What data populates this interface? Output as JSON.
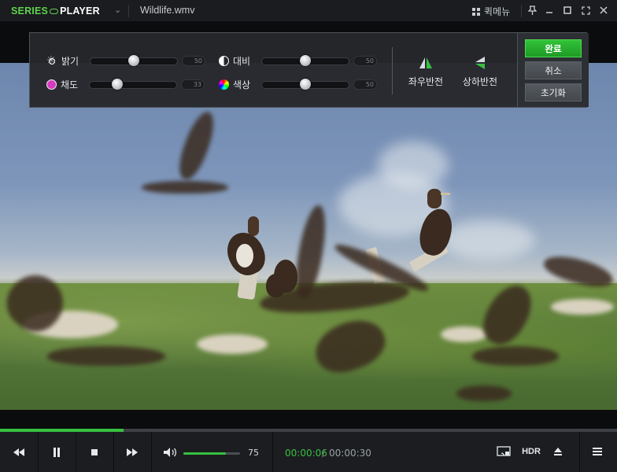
{
  "titlebar": {
    "logo_part1": "SERIES",
    "logo_part2": "PLAYER",
    "filename": "Wildlife.wmv",
    "quick_menu": "퀵메뉴"
  },
  "adjust_panel": {
    "brightness": {
      "label": "밝기",
      "value": "50"
    },
    "saturation": {
      "label": "채도",
      "value": "33"
    },
    "contrast": {
      "label": "대비",
      "value": "50"
    },
    "hue": {
      "label": "색상",
      "value": "50"
    },
    "flip_horizontal": "좌우반전",
    "flip_vertical": "상하반전",
    "done": "완료",
    "cancel": "취소",
    "reset": "초기화"
  },
  "player": {
    "volume": "75",
    "current_time": "00:00:06",
    "separator": "/",
    "total_time": "00:00:30",
    "hdr": "HDR",
    "progress": 0.2
  },
  "colors": {
    "accent": "#37c040",
    "panel": "#26282c"
  }
}
